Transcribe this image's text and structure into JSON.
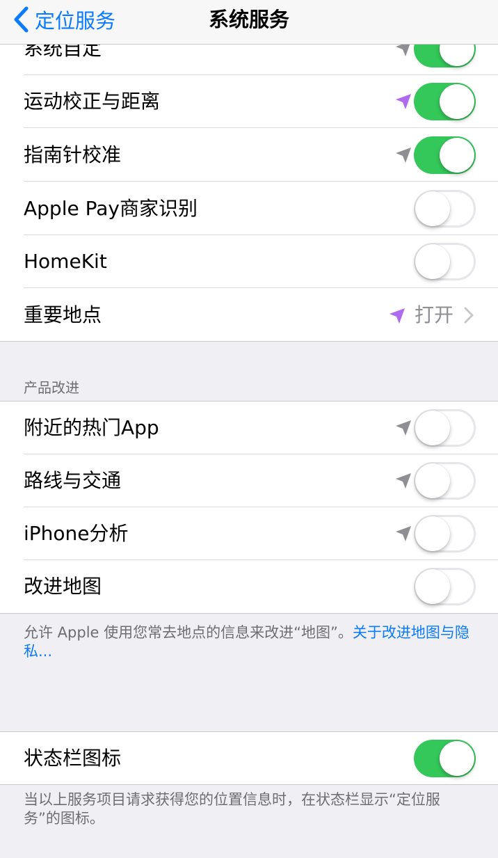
{
  "nav": {
    "back_label": "定位服务",
    "title": "系统服务"
  },
  "rows_top": [
    {
      "label": "系统自定",
      "arrow": "gray",
      "toggle": "on"
    },
    {
      "label": "运动校正与距离",
      "arrow": "purple",
      "toggle": "on"
    },
    {
      "label": "指南针校准",
      "arrow": "gray",
      "toggle": "on"
    },
    {
      "label": "Apple Pay商家识别",
      "arrow": "",
      "toggle": "off"
    },
    {
      "label": "HomeKit",
      "arrow": "",
      "toggle": "off"
    },
    {
      "label": "重要地点",
      "arrow": "purple",
      "value": "打开"
    }
  ],
  "product_section": {
    "header": "产品改进",
    "rows": [
      {
        "label": "附近的热门App",
        "arrow": "gray",
        "toggle": "off"
      },
      {
        "label": "路线与交通",
        "arrow": "gray",
        "toggle": "off"
      },
      {
        "label": "iPhone分析",
        "arrow": "gray",
        "toggle": "off"
      },
      {
        "label": "改进地图",
        "arrow": "",
        "toggle": "off"
      }
    ],
    "footer_text": "允许 Apple 使用您常去地点的信息来改进“地图”。",
    "footer_link": "关于改进地图与隐私..."
  },
  "status_section": {
    "row": {
      "label": "状态栏图标",
      "toggle": "on"
    },
    "footer_text": "当以上服务项目请求获得您的位置信息时，在状态栏显示“定位服务”的图标。"
  },
  "colors": {
    "accent": "#0a7aff",
    "toggle_on": "#34c759",
    "arrow_purple": "#b06af0",
    "arrow_gray": "#8e8e93"
  },
  "icons": {
    "back": "chevron-left-icon",
    "location": "location-arrow-icon",
    "disclosure": "chevron-right-icon"
  }
}
